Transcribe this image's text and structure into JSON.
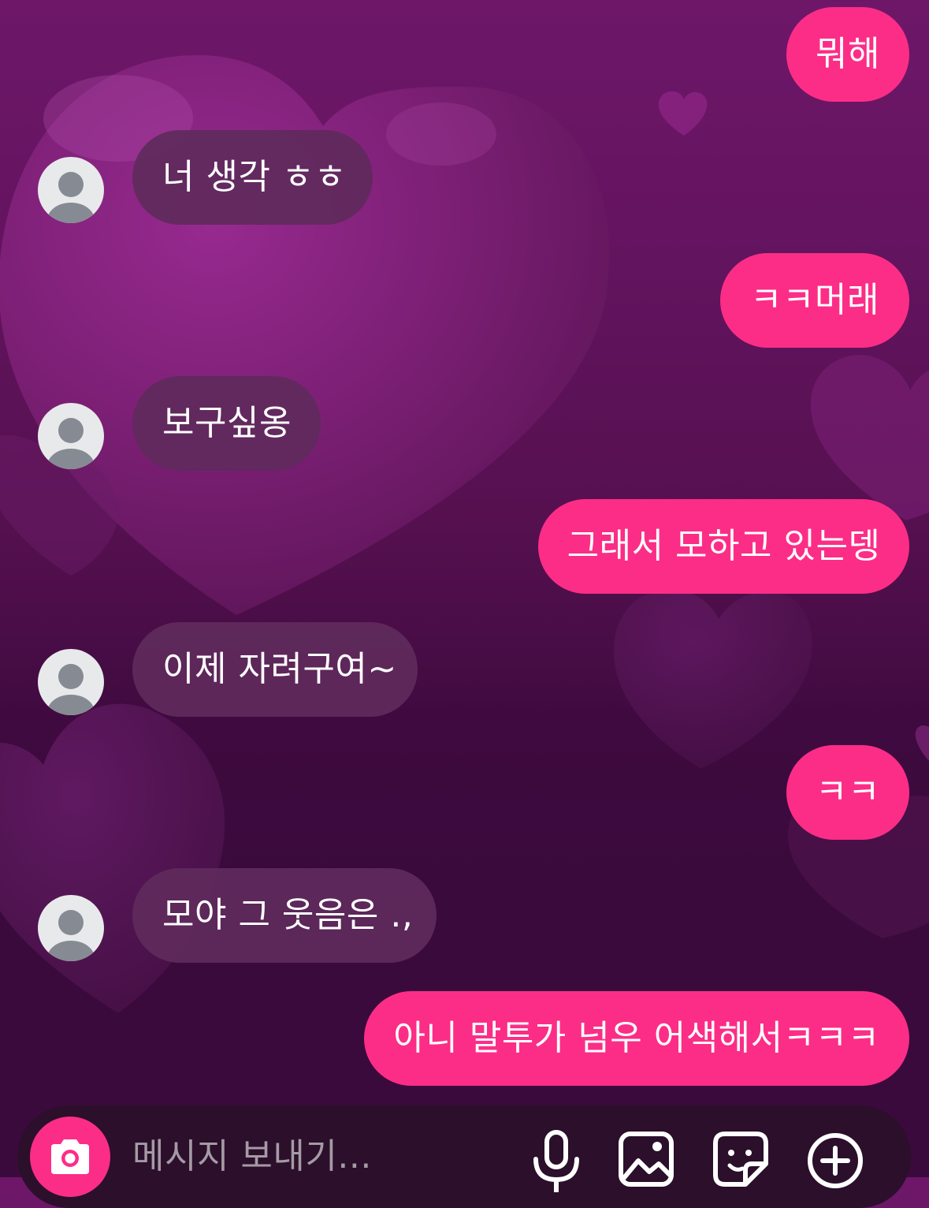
{
  "theme": {
    "outgoing_bubble_color": "#fc2d87",
    "incoming_bubble_color": "#602a5c",
    "background_primary": "#6e1769",
    "background_secondary": "#3b0a3c",
    "heart_color": "#7d2076"
  },
  "messages": [
    {
      "direction": "outgoing",
      "text": "뭐해"
    },
    {
      "direction": "incoming",
      "text": "너 생각 ㅎㅎ",
      "avatar_icon": "default-user-icon"
    },
    {
      "direction": "outgoing",
      "text": "ㅋㅋ머래"
    },
    {
      "direction": "incoming",
      "text": "보구싶옹",
      "avatar_icon": "default-user-icon"
    },
    {
      "direction": "outgoing",
      "text": "그래서 모하고 있는뎅"
    },
    {
      "direction": "incoming",
      "text": "이제 자려구여~",
      "avatar_icon": "default-user-icon"
    },
    {
      "direction": "outgoing",
      "text": "ㅋㅋ"
    },
    {
      "direction": "incoming",
      "text": "모야 그 웃음은 .,",
      "avatar_icon": "default-user-icon"
    },
    {
      "direction": "outgoing",
      "text": "아니 말투가 넘우 어색해서ㅋㅋㅋ"
    }
  ],
  "composer": {
    "placeholder": "메시지 보내기...",
    "value": "",
    "camera_icon": "camera-icon",
    "tools": [
      "microphone-icon",
      "gallery-icon",
      "sticker-icon",
      "plus-circle-icon"
    ]
  }
}
